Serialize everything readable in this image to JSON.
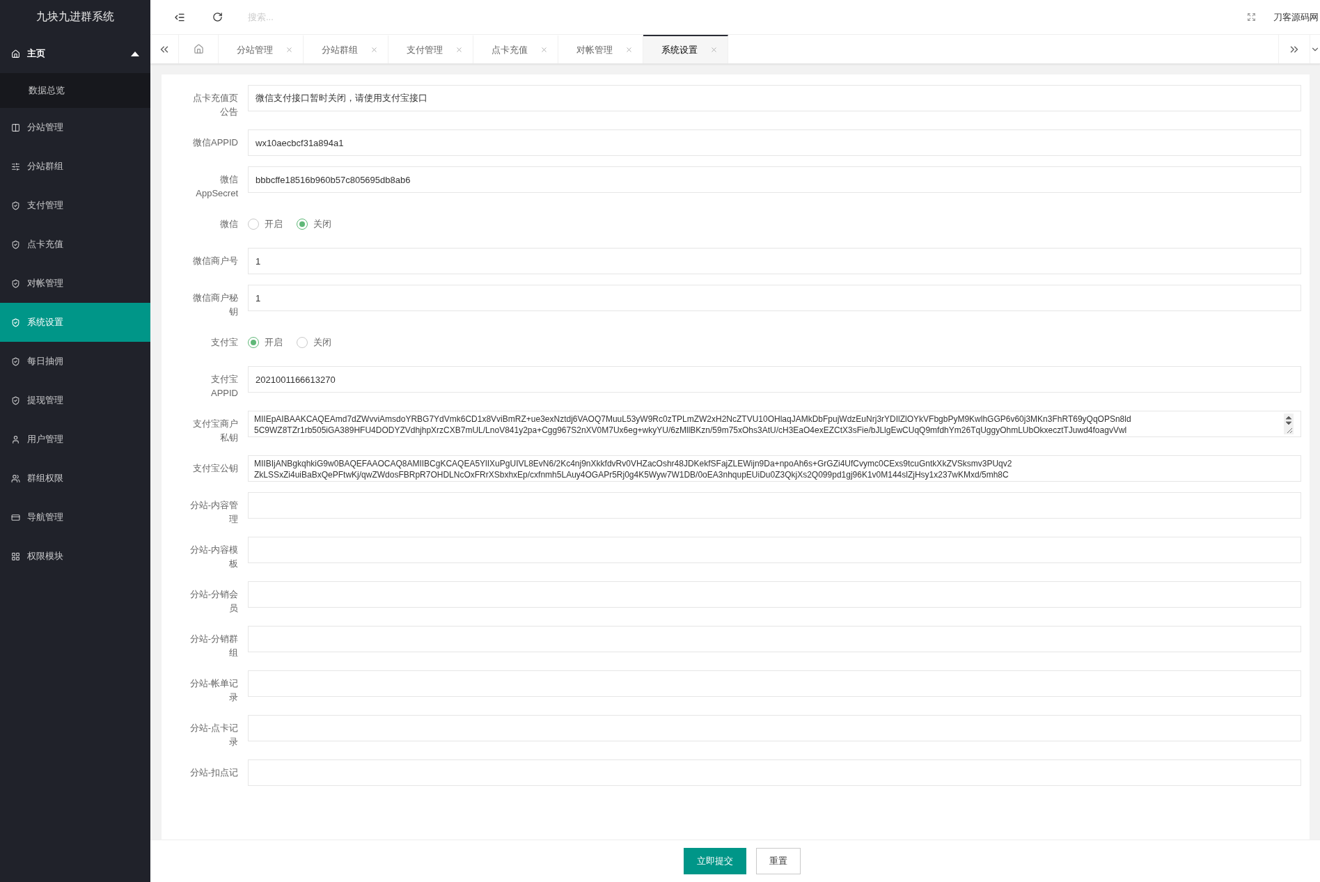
{
  "sidebar": {
    "brand": "九块九进群系统",
    "menu": [
      {
        "label": "主页",
        "selected": false,
        "expanded": true,
        "children": [
          {
            "label": "数据总览",
            "selected": false
          }
        ]
      },
      {
        "label": "分站管理",
        "selected": false
      },
      {
        "label": "分站群组",
        "selected": false
      },
      {
        "label": "支付管理",
        "selected": false
      },
      {
        "label": "点卡充值",
        "selected": false
      },
      {
        "label": "对帐管理",
        "selected": false
      },
      {
        "label": "系统设置",
        "selected": true
      },
      {
        "label": "每日抽佣",
        "selected": false
      },
      {
        "label": "提现管理",
        "selected": false
      },
      {
        "label": "用户管理",
        "selected": false
      },
      {
        "label": "群组权限",
        "selected": false
      },
      {
        "label": "导航管理",
        "selected": false
      },
      {
        "label": "权限模块",
        "selected": false
      }
    ]
  },
  "header": {
    "search": {
      "placeholder": "搜索..."
    },
    "user": "刀客源码网"
  },
  "tabs": [
    {
      "label": "分站管理",
      "selected": false
    },
    {
      "label": "分站群组",
      "selected": false
    },
    {
      "label": "支付管理",
      "selected": false
    },
    {
      "label": "点卡充值",
      "selected": false
    },
    {
      "label": "对帐管理",
      "selected": false
    },
    {
      "label": "系统设置",
      "selected": true
    }
  ],
  "form": {
    "fields": [
      {
        "kind": "text",
        "label": "点卡充值页公告",
        "value": "微信支付接口暂时关闭，请使用支付宝接口"
      },
      {
        "kind": "text",
        "label": "微信APPID",
        "value": "wx10aecbcf31a894a1"
      },
      {
        "kind": "text",
        "label": "微信AppSecret",
        "value": "bbbcffe18516b960b57c805695db8ab6"
      },
      {
        "kind": "radio",
        "label": "微信",
        "options": [
          {
            "label": "开启",
            "selected": false
          },
          {
            "label": "关闭",
            "selected": true
          }
        ]
      },
      {
        "kind": "text",
        "label": "微信商户号",
        "value": "1"
      },
      {
        "kind": "text",
        "label": "微信商户秘钥",
        "value": "1"
      },
      {
        "kind": "radio",
        "label": "支付宝",
        "options": [
          {
            "label": "开启",
            "selected": true
          },
          {
            "label": "关闭",
            "selected": false
          }
        ]
      },
      {
        "kind": "text",
        "label": "支付宝APPID",
        "value": "2021001166613270"
      },
      {
        "kind": "textarea",
        "label": "支付宝商户私钥",
        "scrollbar": true,
        "lines": [
          "MIIEpAIBAAKCAQEAmd7dZWvviAmsdoYRBG7YdVmk6CD1x8VviBmRZ+ue3exNztdj6VAOQ7MuuL53yW9Rc0zTPLmZW2xH2NcZTVU10OHlaqJAMkDbFpujWdzEuNrj3rYDIlZlOYkVFbgbPyM9KwlhGGP6v60j3MKn3FhRT69yQqOPSn8ld",
          "5C9WZ8TZr1rb505iGA389HFU4DODYZVdhjhpXrzCXB7mUL/LnoV841y2pa+Cgg967S2nXV0M7Ux6eg+wkyYU/6zMllBKzn/59m75xOhs3AtU/cH3EaO4exEZCtX3sFie/bJLlgEwCUqQ9mfdhYm26TqUggyOhmLUbOkxecztTJuwd4foagvVwl"
        ]
      },
      {
        "kind": "textarea",
        "label": "支付宝公钥",
        "scrollbar": false,
        "lines": [
          "MIIBIjANBgkqhkiG9w0BAQEFAAOCAQ8AMIIBCgKCAQEA5YlIXuPgUIVL8EvN6/2Kc4nj9nXkkfdvRv0VHZacOshr48JDKekfSFajZLEWijn9Da+npoAh6s+GrGZi4UfCvymc0CExs9tcuGntkXkZVSksmv3PUqv2",
          "ZkLSSxZi4uiBaBxQePFtwKj/qwZWdosFBRpR7OHDLNcOxFRrXSbxhxEp/cxfnmh5LAuy4OGAPr5Rj0g4K5Wyw7W1DB/0oEA3nhqupEUiDu0Z3QkjXs2Q099pd1gj96K1v0M144slZjHsy1x237wKMxd/5mh8C"
        ]
      },
      {
        "kind": "text",
        "label": "分站-内容管理"
      },
      {
        "kind": "text",
        "label": "分站-内容模板"
      },
      {
        "kind": "text",
        "label": "分站-分销会员"
      },
      {
        "kind": "text",
        "label": "分站-分销群组"
      },
      {
        "kind": "text",
        "label": "分站-帐单记录"
      },
      {
        "kind": "text",
        "label": "分站-点卡记录"
      },
      {
        "kind": "text",
        "label": "分站-扣点记"
      }
    ]
  },
  "buttons": [
    {
      "label": "立即提交",
      "kind": "primary"
    },
    {
      "label": "重置",
      "kind": "default"
    }
  ]
}
